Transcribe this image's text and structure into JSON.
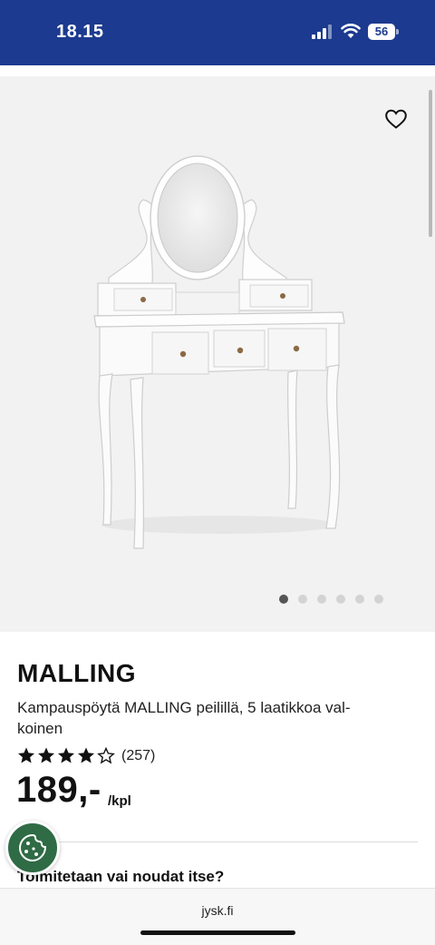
{
  "status_bar": {
    "time": "18.15",
    "battery": "56",
    "background_color": "#1c3a8f"
  },
  "gallery": {
    "image_name": "vanity-table-with-oval-mirror-white",
    "favorite_icon": "heart-outline-icon",
    "dots_count": 6,
    "active_dot": 0,
    "background_color": "#f2f2f2"
  },
  "product": {
    "brand": "MALLING",
    "description": "Kampauspöytä MALLING peilillä, 5 laatikkoa valkoinen",
    "description_line1": "Kampauspöytä MALLING peilillä, 5 laatikkoa val-",
    "description_line2": "koinen",
    "rating_value": 4,
    "rating_max": 5,
    "reviews_count": "(257)",
    "price": "189,-",
    "price_unit": "/kpl"
  },
  "delivery": {
    "heading": "Toimitetaan vai noudat itse?"
  },
  "cookie_button": {
    "icon": "cookie-icon",
    "color": "#2f6b45"
  },
  "browser": {
    "url": "jysk.fi"
  }
}
